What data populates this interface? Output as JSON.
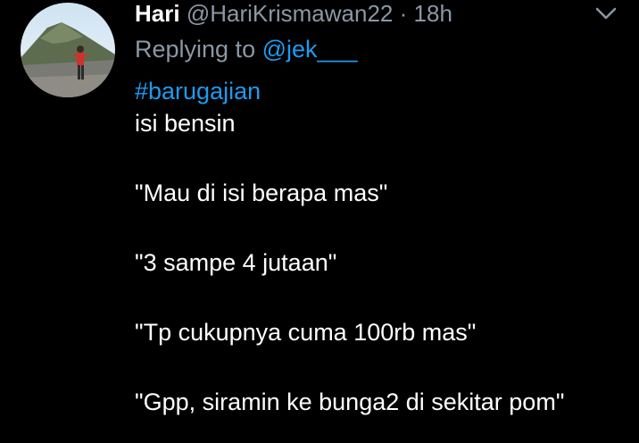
{
  "author": {
    "name": "Hari",
    "handle": "@HariKrismawan22",
    "separator": "·",
    "time": "18h"
  },
  "reply": {
    "prefix": "Replying to ",
    "mention": "@jek___"
  },
  "body": {
    "hashtag": "#barugajian",
    "lines": [
      "isi bensin",
      "\"Mau di isi berapa mas\"",
      "\"3 sampe 4 jutaan\"",
      "\"Tp cukupnya cuma 100rb mas\"",
      "\"Gpp, siramin ke bunga2 di sekitar pom\""
    ]
  },
  "icons": {
    "avatar": "profile-photo",
    "menu": "chevron-down-icon"
  },
  "colors": {
    "background": "#000000",
    "text": "#ffffff",
    "muted": "#8b98a5",
    "link": "#1d9bf0"
  }
}
